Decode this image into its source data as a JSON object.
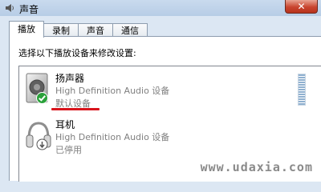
{
  "window": {
    "title": "声音",
    "close_label": "✕"
  },
  "tabs": [
    {
      "label": "播放",
      "active": true
    },
    {
      "label": "录制",
      "active": false
    },
    {
      "label": "声音",
      "active": false
    },
    {
      "label": "通信",
      "active": false
    }
  ],
  "playback": {
    "instruction": "选择以下播放设备来修改设置:",
    "devices": [
      {
        "name": "扬声器",
        "description": "High Definition Audio 设备",
        "status": "默认设备",
        "icon": "speaker-icon",
        "badge": "check-icon",
        "badge_color": "#2aa13a"
      },
      {
        "name": "耳机",
        "description": "High Definition Audio 设备",
        "status": "已停用",
        "icon": "headphones-icon",
        "badge": "disabled-icon",
        "badge_color": "#555555"
      }
    ]
  },
  "watermark": "www.udaxia.com",
  "colors": {
    "highlight_underline": "#d8141c",
    "close_button": "#c9452f"
  }
}
